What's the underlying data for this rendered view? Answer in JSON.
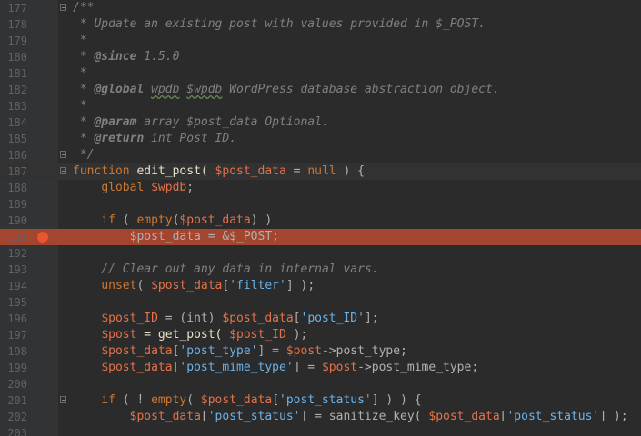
{
  "editor": {
    "breakpoint_line": 191,
    "lines": [
      {
        "n": "177",
        "fold": true,
        "segs": [
          {
            "t": "/**",
            "c": "t-comment"
          }
        ]
      },
      {
        "n": "178",
        "segs": [
          {
            "t": " * Update an existing post with values provided in $_POST.",
            "c": "t-comment"
          }
        ]
      },
      {
        "n": "179",
        "segs": [
          {
            "t": " *",
            "c": "t-comment"
          }
        ]
      },
      {
        "n": "180",
        "segs": [
          {
            "t": " * ",
            "c": "t-comment"
          },
          {
            "t": "@since",
            "c": "t-tag"
          },
          {
            "t": " 1.5.0",
            "c": "t-comment"
          }
        ]
      },
      {
        "n": "181",
        "segs": [
          {
            "t": " *",
            "c": "t-comment"
          }
        ]
      },
      {
        "n": "182",
        "segs": [
          {
            "t": " * ",
            "c": "t-comment"
          },
          {
            "t": "@global",
            "c": "t-tag"
          },
          {
            "t": " ",
            "c": "t-comment"
          },
          {
            "t": "wpdb",
            "c": "t-comment t-typo"
          },
          {
            "t": " ",
            "c": "t-comment"
          },
          {
            "t": "$wpdb",
            "c": "t-comment t-typo"
          },
          {
            "t": " WordPress database abstraction object.",
            "c": "t-comment"
          }
        ]
      },
      {
        "n": "183",
        "segs": [
          {
            "t": " *",
            "c": "t-comment"
          }
        ]
      },
      {
        "n": "184",
        "segs": [
          {
            "t": " * ",
            "c": "t-comment"
          },
          {
            "t": "@param",
            "c": "t-tag"
          },
          {
            "t": " array $post_data Optional.",
            "c": "t-comment"
          }
        ]
      },
      {
        "n": "185",
        "segs": [
          {
            "t": " * ",
            "c": "t-comment"
          },
          {
            "t": "@return",
            "c": "t-tag"
          },
          {
            "t": " int Post ID.",
            "c": "t-comment"
          }
        ]
      },
      {
        "n": "186",
        "fold": true,
        "segs": [
          {
            "t": " */",
            "c": "t-comment"
          }
        ]
      },
      {
        "n": "187",
        "fold": true,
        "current": true,
        "segs": [
          {
            "t": "function",
            "c": "t-kw"
          },
          {
            "t": " edit_post( ",
            "c": "t-fn"
          },
          {
            "t": "$post_data",
            "c": "t-var"
          },
          {
            "t": " = ",
            "c": "t-plain"
          },
          {
            "t": "null",
            "c": "t-null"
          },
          {
            "t": " ) {",
            "c": "t-plain"
          }
        ]
      },
      {
        "n": "188",
        "segs": [
          {
            "t": "    ",
            "c": "t-plain"
          },
          {
            "t": "global",
            "c": "t-kw"
          },
          {
            "t": " ",
            "c": "t-plain"
          },
          {
            "t": "$wpdb",
            "c": "t-var"
          },
          {
            "t": ";",
            "c": "t-plain"
          }
        ]
      },
      {
        "n": "189",
        "segs": []
      },
      {
        "n": "190",
        "segs": [
          {
            "t": "    ",
            "c": "t-plain"
          },
          {
            "t": "if",
            "c": "t-kw"
          },
          {
            "t": " ( ",
            "c": "t-plain"
          },
          {
            "t": "empty",
            "c": "t-kw"
          },
          {
            "t": "(",
            "c": "t-plain"
          },
          {
            "t": "$post_data",
            "c": "t-var"
          },
          {
            "t": ") )",
            "c": "t-plain"
          }
        ]
      },
      {
        "n": "191",
        "bp": true,
        "segs": [
          {
            "t": "        $post_data = &$_POST;",
            "c": "t-plain"
          }
        ]
      },
      {
        "n": "192",
        "segs": []
      },
      {
        "n": "193",
        "segs": [
          {
            "t": "    ",
            "c": "t-plain"
          },
          {
            "t": "// Clear out any data in internal vars.",
            "c": "t-comment"
          }
        ]
      },
      {
        "n": "194",
        "segs": [
          {
            "t": "    ",
            "c": "t-plain"
          },
          {
            "t": "unset",
            "c": "t-kw"
          },
          {
            "t": "( ",
            "c": "t-plain"
          },
          {
            "t": "$post_data",
            "c": "t-var"
          },
          {
            "t": "[",
            "c": "t-plain"
          },
          {
            "t": "'filter'",
            "c": "t-key"
          },
          {
            "t": "] );",
            "c": "t-plain"
          }
        ]
      },
      {
        "n": "195",
        "segs": []
      },
      {
        "n": "196",
        "segs": [
          {
            "t": "    ",
            "c": "t-plain"
          },
          {
            "t": "$post_ID",
            "c": "t-var"
          },
          {
            "t": " = (int) ",
            "c": "t-plain"
          },
          {
            "t": "$post_data",
            "c": "t-var"
          },
          {
            "t": "[",
            "c": "t-plain"
          },
          {
            "t": "'post_ID'",
            "c": "t-key"
          },
          {
            "t": "];",
            "c": "t-plain"
          }
        ]
      },
      {
        "n": "197",
        "segs": [
          {
            "t": "    ",
            "c": "t-plain"
          },
          {
            "t": "$post",
            "c": "t-var"
          },
          {
            "t": " = get_post( ",
            "c": "t-fn"
          },
          {
            "t": "$post_ID",
            "c": "t-var"
          },
          {
            "t": " );",
            "c": "t-plain"
          }
        ]
      },
      {
        "n": "198",
        "segs": [
          {
            "t": "    ",
            "c": "t-plain"
          },
          {
            "t": "$post_data",
            "c": "t-var"
          },
          {
            "t": "[",
            "c": "t-plain"
          },
          {
            "t": "'post_type'",
            "c": "t-key"
          },
          {
            "t": "] = ",
            "c": "t-plain"
          },
          {
            "t": "$post",
            "c": "t-var"
          },
          {
            "t": "->post_type;",
            "c": "t-plain"
          }
        ]
      },
      {
        "n": "199",
        "segs": [
          {
            "t": "    ",
            "c": "t-plain"
          },
          {
            "t": "$post_data",
            "c": "t-var"
          },
          {
            "t": "[",
            "c": "t-plain"
          },
          {
            "t": "'post_mime_type'",
            "c": "t-key"
          },
          {
            "t": "] = ",
            "c": "t-plain"
          },
          {
            "t": "$post",
            "c": "t-var"
          },
          {
            "t": "->post_mime_type;",
            "c": "t-plain"
          }
        ]
      },
      {
        "n": "200",
        "segs": []
      },
      {
        "n": "201",
        "fold": true,
        "segs": [
          {
            "t": "    ",
            "c": "t-plain"
          },
          {
            "t": "if",
            "c": "t-kw"
          },
          {
            "t": " ( ! ",
            "c": "t-plain"
          },
          {
            "t": "empty",
            "c": "t-kw"
          },
          {
            "t": "( ",
            "c": "t-plain"
          },
          {
            "t": "$post_data",
            "c": "t-var"
          },
          {
            "t": "[",
            "c": "t-plain"
          },
          {
            "t": "'post_status'",
            "c": "t-key"
          },
          {
            "t": "] ) ) {",
            "c": "t-plain"
          }
        ]
      },
      {
        "n": "202",
        "segs": [
          {
            "t": "        ",
            "c": "t-plain"
          },
          {
            "t": "$post_data",
            "c": "t-var"
          },
          {
            "t": "[",
            "c": "t-plain"
          },
          {
            "t": "'post_status'",
            "c": "t-key"
          },
          {
            "t": "] = sanitize_key( ",
            "c": "t-plain"
          },
          {
            "t": "$post_data",
            "c": "t-var"
          },
          {
            "t": "[",
            "c": "t-plain"
          },
          {
            "t": "'post_status'",
            "c": "t-key"
          },
          {
            "t": "] );",
            "c": "t-plain"
          }
        ]
      },
      {
        "n": "203",
        "segs": []
      }
    ]
  }
}
